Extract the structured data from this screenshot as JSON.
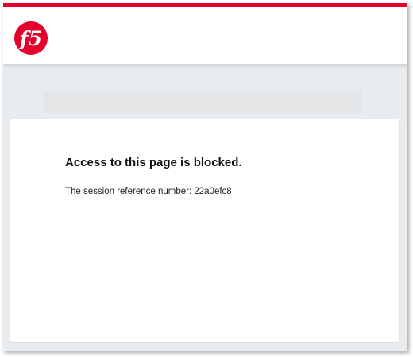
{
  "header": {
    "logo_icon": "f5-logo-icon",
    "logo_text": "f5",
    "accent_color": "#e4002b"
  },
  "message": {
    "title": "Access to this page is blocked.",
    "session_label": "The session reference number:",
    "session_id": "22a0efc8"
  }
}
